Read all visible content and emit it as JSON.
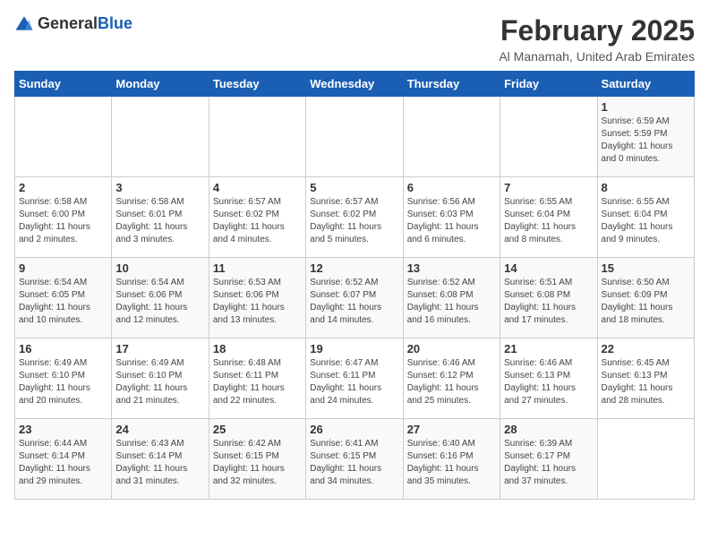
{
  "header": {
    "logo_general": "General",
    "logo_blue": "Blue",
    "month_year": "February 2025",
    "location": "Al Manamah, United Arab Emirates"
  },
  "weekdays": [
    "Sunday",
    "Monday",
    "Tuesday",
    "Wednesday",
    "Thursday",
    "Friday",
    "Saturday"
  ],
  "weeks": [
    [
      {
        "day": "",
        "info": ""
      },
      {
        "day": "",
        "info": ""
      },
      {
        "day": "",
        "info": ""
      },
      {
        "day": "",
        "info": ""
      },
      {
        "day": "",
        "info": ""
      },
      {
        "day": "",
        "info": ""
      },
      {
        "day": "1",
        "info": "Sunrise: 6:59 AM\nSunset: 5:59 PM\nDaylight: 11 hours\nand 0 minutes."
      }
    ],
    [
      {
        "day": "2",
        "info": "Sunrise: 6:58 AM\nSunset: 6:00 PM\nDaylight: 11 hours\nand 2 minutes."
      },
      {
        "day": "3",
        "info": "Sunrise: 6:58 AM\nSunset: 6:01 PM\nDaylight: 11 hours\nand 3 minutes."
      },
      {
        "day": "4",
        "info": "Sunrise: 6:57 AM\nSunset: 6:02 PM\nDaylight: 11 hours\nand 4 minutes."
      },
      {
        "day": "5",
        "info": "Sunrise: 6:57 AM\nSunset: 6:02 PM\nDaylight: 11 hours\nand 5 minutes."
      },
      {
        "day": "6",
        "info": "Sunrise: 6:56 AM\nSunset: 6:03 PM\nDaylight: 11 hours\nand 6 minutes."
      },
      {
        "day": "7",
        "info": "Sunrise: 6:55 AM\nSunset: 6:04 PM\nDaylight: 11 hours\nand 8 minutes."
      },
      {
        "day": "8",
        "info": "Sunrise: 6:55 AM\nSunset: 6:04 PM\nDaylight: 11 hours\nand 9 minutes."
      }
    ],
    [
      {
        "day": "9",
        "info": "Sunrise: 6:54 AM\nSunset: 6:05 PM\nDaylight: 11 hours\nand 10 minutes."
      },
      {
        "day": "10",
        "info": "Sunrise: 6:54 AM\nSunset: 6:06 PM\nDaylight: 11 hours\nand 12 minutes."
      },
      {
        "day": "11",
        "info": "Sunrise: 6:53 AM\nSunset: 6:06 PM\nDaylight: 11 hours\nand 13 minutes."
      },
      {
        "day": "12",
        "info": "Sunrise: 6:52 AM\nSunset: 6:07 PM\nDaylight: 11 hours\nand 14 minutes."
      },
      {
        "day": "13",
        "info": "Sunrise: 6:52 AM\nSunset: 6:08 PM\nDaylight: 11 hours\nand 16 minutes."
      },
      {
        "day": "14",
        "info": "Sunrise: 6:51 AM\nSunset: 6:08 PM\nDaylight: 11 hours\nand 17 minutes."
      },
      {
        "day": "15",
        "info": "Sunrise: 6:50 AM\nSunset: 6:09 PM\nDaylight: 11 hours\nand 18 minutes."
      }
    ],
    [
      {
        "day": "16",
        "info": "Sunrise: 6:49 AM\nSunset: 6:10 PM\nDaylight: 11 hours\nand 20 minutes."
      },
      {
        "day": "17",
        "info": "Sunrise: 6:49 AM\nSunset: 6:10 PM\nDaylight: 11 hours\nand 21 minutes."
      },
      {
        "day": "18",
        "info": "Sunrise: 6:48 AM\nSunset: 6:11 PM\nDaylight: 11 hours\nand 22 minutes."
      },
      {
        "day": "19",
        "info": "Sunrise: 6:47 AM\nSunset: 6:11 PM\nDaylight: 11 hours\nand 24 minutes."
      },
      {
        "day": "20",
        "info": "Sunrise: 6:46 AM\nSunset: 6:12 PM\nDaylight: 11 hours\nand 25 minutes."
      },
      {
        "day": "21",
        "info": "Sunrise: 6:46 AM\nSunset: 6:13 PM\nDaylight: 11 hours\nand 27 minutes."
      },
      {
        "day": "22",
        "info": "Sunrise: 6:45 AM\nSunset: 6:13 PM\nDaylight: 11 hours\nand 28 minutes."
      }
    ],
    [
      {
        "day": "23",
        "info": "Sunrise: 6:44 AM\nSunset: 6:14 PM\nDaylight: 11 hours\nand 29 minutes."
      },
      {
        "day": "24",
        "info": "Sunrise: 6:43 AM\nSunset: 6:14 PM\nDaylight: 11 hours\nand 31 minutes."
      },
      {
        "day": "25",
        "info": "Sunrise: 6:42 AM\nSunset: 6:15 PM\nDaylight: 11 hours\nand 32 minutes."
      },
      {
        "day": "26",
        "info": "Sunrise: 6:41 AM\nSunset: 6:15 PM\nDaylight: 11 hours\nand 34 minutes."
      },
      {
        "day": "27",
        "info": "Sunrise: 6:40 AM\nSunset: 6:16 PM\nDaylight: 11 hours\nand 35 minutes."
      },
      {
        "day": "28",
        "info": "Sunrise: 6:39 AM\nSunset: 6:17 PM\nDaylight: 11 hours\nand 37 minutes."
      },
      {
        "day": "",
        "info": ""
      }
    ]
  ]
}
